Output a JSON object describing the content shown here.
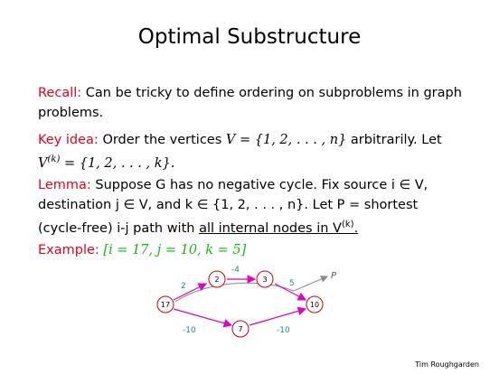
{
  "slide": {
    "title": "Optimal Substructure",
    "recall": {
      "label": "Recall:",
      "text": "Can be tricky to define ordering on subproblems in graph problems."
    },
    "key_idea": {
      "label": "Key idea:",
      "text_1": "Order the vertices",
      "set_V": "V = {1, 2, . . . , n}",
      "text_2": "arbitrarily. Let",
      "set_Vk": "V(k) = {1, 2, . . . , k}."
    },
    "lemma": {
      "label": "Lemma:",
      "text_1": "Suppose G has no negative cycle. Fix source i ∈ V,",
      "text_2": "destination j ∈ V, and k ∈ {1, 2, . . . , n}. Let P = shortest",
      "text_3": "(cycle-free) i-j path with",
      "underlined": "all internal nodes in V(k)."
    },
    "example": {
      "label": "Example:",
      "params": "[i = 17, j = 10, k = 5]"
    },
    "credit": "Tim Roughgarden"
  },
  "graph": {
    "nodes": [
      "17",
      "2",
      "3",
      "10",
      "7"
    ],
    "edge_weights": {
      "e17_2": "2",
      "e2_3": "-4",
      "e3_10": "5",
      "e17_7": "-10",
      "e7_10": "-10"
    },
    "path_label": "P",
    "colors": {
      "edge": "#e000c8",
      "weight": "#1b8a8a",
      "path": "#888888",
      "node_stroke": "#d00000"
    }
  }
}
